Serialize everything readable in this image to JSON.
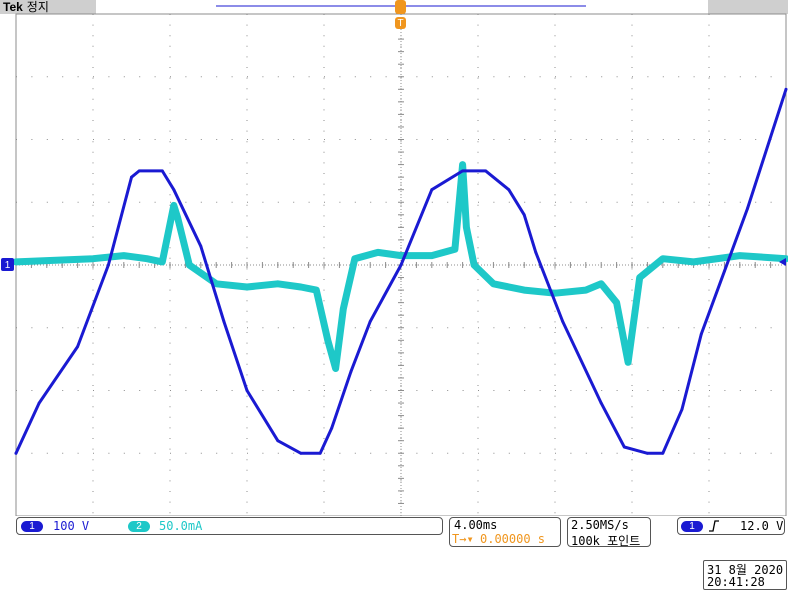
{
  "app": {
    "brand": "Tek",
    "mode": "정지"
  },
  "markers": {
    "trigger_label": "T",
    "ch1_level_label": "1"
  },
  "channels": [
    {
      "number": "1",
      "scale": "100 V",
      "color": "#1a1ad2"
    },
    {
      "number": "2",
      "scale": "50.0mA",
      "color": "#1ec8c8"
    }
  ],
  "horizontal": {
    "timebase": "4.00ms",
    "position": "0.00000 s",
    "position_icon": "T→▾"
  },
  "acquisition": {
    "sample_rate": "2.50MS/s",
    "record_length": "100k 포인트"
  },
  "trigger": {
    "source": "1",
    "slope_icon": "rising-edge-icon",
    "level": "12.0 V"
  },
  "datetime": {
    "date": "31 8월  2020",
    "time": "20:41:28"
  },
  "colors": {
    "ch1": "#1a1ad2",
    "ch2": "#1ec8c8",
    "trigger": "#f0961e",
    "grid": "#8c8c8c"
  },
  "chart_data": {
    "type": "line",
    "title": "",
    "xlabel": "",
    "ylabel": "",
    "grid": true,
    "x_divisions": 10,
    "y_divisions": 8,
    "xlim": [
      -5,
      5
    ],
    "ylim": [
      -4,
      4
    ],
    "series": [
      {
        "name": "1",
        "x": [
          -5,
          -4.7,
          -4.2,
          -3.8,
          -3.5,
          -3.4,
          -3.1,
          -2.95,
          -2.6,
          -2.3,
          -2.0,
          -1.6,
          -1.3,
          -1.05,
          -0.9,
          -0.65,
          -0.4,
          0,
          0.4,
          0.8,
          1.1,
          1.4,
          1.6,
          1.75,
          2.1,
          2.6,
          2.9,
          3.2,
          3.4,
          3.65,
          3.9,
          4.2,
          4.5,
          5
        ],
        "y": [
          -3.0,
          -2.2,
          -1.3,
          0.0,
          1.4,
          1.5,
          1.5,
          1.2,
          0.3,
          -0.9,
          -2.0,
          -2.8,
          -3.0,
          -3.0,
          -2.6,
          -1.7,
          -0.9,
          0.0,
          1.2,
          1.5,
          1.5,
          1.2,
          0.8,
          0.2,
          -0.9,
          -2.2,
          -2.9,
          -3.0,
          -3.0,
          -2.3,
          -1.1,
          -0.1,
          0.9,
          2.8
        ]
      },
      {
        "name": "2",
        "x": [
          -5,
          -4.0,
          -3.6,
          -3.3,
          -3.1,
          -2.95,
          -2.9,
          -2.75,
          -2.4,
          -2.0,
          -1.6,
          -1.3,
          -1.1,
          -0.95,
          -0.85,
          -0.75,
          -0.6,
          -0.3,
          0,
          0.4,
          0.7,
          0.8,
          0.85,
          0.95,
          1.2,
          1.6,
          2.0,
          2.4,
          2.6,
          2.8,
          2.95,
          3.1,
          3.4,
          3.8,
          4.4,
          5
        ],
        "y": [
          0.05,
          0.1,
          0.15,
          0.1,
          0.05,
          0.95,
          0.75,
          0.0,
          -0.3,
          -0.35,
          -0.3,
          -0.35,
          -0.4,
          -1.2,
          -1.65,
          -0.7,
          0.1,
          0.2,
          0.15,
          0.15,
          0.25,
          1.6,
          0.6,
          0.0,
          -0.3,
          -0.4,
          -0.45,
          -0.4,
          -0.3,
          -0.6,
          -1.55,
          -0.2,
          0.1,
          0.05,
          0.15,
          0.1
        ]
      }
    ]
  }
}
